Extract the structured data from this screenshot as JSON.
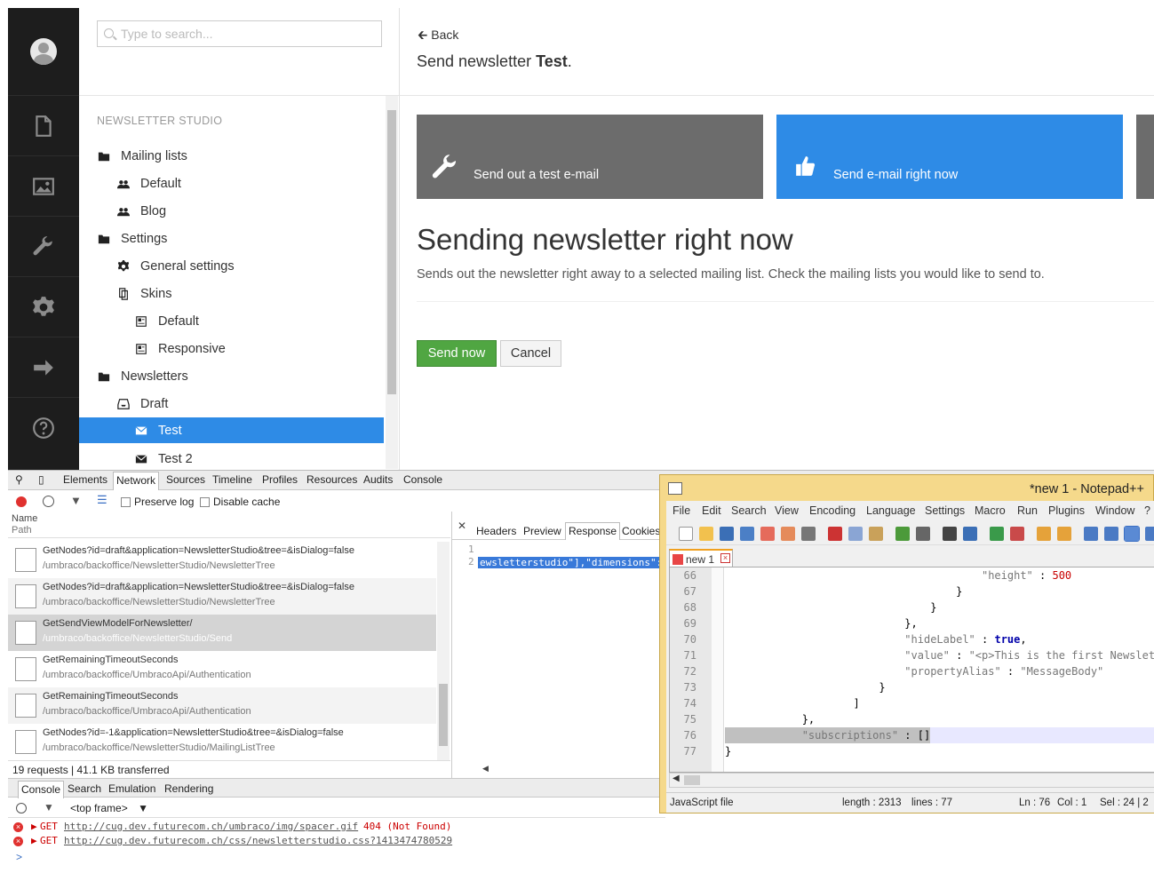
{
  "sidebar": {
    "icons": [
      "avatar",
      "document-icon",
      "image-icon",
      "wrench-icon",
      "gear-icon",
      "arrow-right-icon",
      "help-icon"
    ]
  },
  "tree": {
    "search_placeholder": "Type to search...",
    "section_title": "NEWSLETTER STUDIO",
    "items": [
      {
        "label": "Mailing lists",
        "icon": "folder-icon"
      },
      {
        "label": "Default",
        "icon": "users-icon"
      },
      {
        "label": "Blog",
        "icon": "users-icon"
      },
      {
        "label": "Settings",
        "icon": "folder-icon"
      },
      {
        "label": "General settings",
        "icon": "gear-icon"
      },
      {
        "label": "Skins",
        "icon": "copy-icon"
      },
      {
        "label": "Default",
        "icon": "template-icon"
      },
      {
        "label": "Responsive",
        "icon": "template-icon"
      },
      {
        "label": "Newsletters",
        "icon": "folder-icon"
      },
      {
        "label": "Draft",
        "icon": "inbox-icon"
      },
      {
        "label": "Test",
        "icon": "envelope-icon",
        "selected": true
      },
      {
        "label": "Test 2",
        "icon": "envelope-icon"
      }
    ]
  },
  "main": {
    "back": "Back",
    "header_prefix": "Send newsletter ",
    "header_name": "Test",
    "header_suffix": ".",
    "tiles": [
      {
        "label": "Send out a test e-mail",
        "color": "#6c6c6c",
        "icon": "wrench-icon"
      },
      {
        "label": "Send e-mail right now",
        "color": "#2e8be6",
        "icon": "thumbs-up-icon"
      }
    ],
    "heading": "Sending newsletter right now",
    "description": "Sends out the newsletter right away to a selected mailing list. Check the mailing lists you would like to send to.",
    "send_now": "Send now",
    "cancel": "Cancel",
    "primary_color": "#50a642"
  },
  "devtools": {
    "tabs": [
      "Elements",
      "Network",
      "Sources",
      "Timeline",
      "Profiles",
      "Resources",
      "Audits",
      "Console"
    ],
    "active_tab": "Network",
    "preserve_log": "Preserve log",
    "disable_cache": "Disable cache",
    "col_name": "Name",
    "col_path": "Path",
    "requests": [
      {
        "name": "GetNodes?id=draft&application=NewsletterStudio&tree=&isDialog=false",
        "path": "/umbraco/backoffice/NewsletterStudio/NewsletterTree"
      },
      {
        "name": "GetNodes?id=draft&application=NewsletterStudio&tree=&isDialog=false",
        "path": "/umbraco/backoffice/NewsletterStudio/NewsletterTree"
      },
      {
        "name": "GetSendViewModelForNewsletter/",
        "path": "/umbraco/backoffice/NewsletterStudio/Send"
      },
      {
        "name": "GetRemainingTimeoutSeconds",
        "path": "/umbraco/backoffice/UmbracoApi/Authentication"
      },
      {
        "name": "GetRemainingTimeoutSeconds",
        "path": "/umbraco/backoffice/UmbracoApi/Authentication"
      },
      {
        "name": "GetNodes?id=-1&application=NewsletterStudio&tree=&isDialog=false",
        "path": "/umbraco/backoffice/NewsletterStudio/MailingListTree"
      }
    ],
    "summary": "19 requests | 41.1 KB transferred",
    "response_tabs": [
      "Headers",
      "Preview",
      "Response",
      "Cookies"
    ],
    "response_active": "Response",
    "response_lines": [
      "1",
      "2"
    ],
    "response_text": "ewsletterstudio\"],\"dimensions\":",
    "console_tabs": [
      "Console",
      "Search",
      "Emulation",
      "Rendering"
    ],
    "frame": "<top frame>",
    "console_errors": [
      {
        "method": "GET",
        "url": "http://cug.dev.futurecom.ch/umbraco/img/spacer.gif",
        "status": "404 (Not Found)"
      },
      {
        "method": "GET",
        "url": "http://cug.dev.futurecom.ch/css/newsletterstudio.css?1413474780529",
        "status": ""
      }
    ],
    "prompt": ">"
  },
  "notepad": {
    "title": "*new  1 - Notepad++",
    "menu": [
      "File",
      "Edit",
      "Search",
      "View",
      "Encoding",
      "Language",
      "Settings",
      "Macro",
      "Run",
      "Plugins",
      "Window",
      "?"
    ],
    "tab": "new  1",
    "lines": [
      {
        "n": "66",
        "parts": [
          {
            "t": "                                        ",
            "c": ""
          },
          {
            "t": "\"height\"",
            "c": "str"
          },
          {
            "t": " : ",
            "c": "pun"
          },
          {
            "t": "500",
            "c": "num"
          }
        ]
      },
      {
        "n": "67",
        "parts": [
          {
            "t": "                                    }",
            "c": "pun"
          }
        ]
      },
      {
        "n": "68",
        "parts": [
          {
            "t": "                                }",
            "c": "pun"
          }
        ]
      },
      {
        "n": "69",
        "parts": [
          {
            "t": "                            },",
            "c": "pun"
          }
        ]
      },
      {
        "n": "70",
        "parts": [
          {
            "t": "                            ",
            "c": ""
          },
          {
            "t": "\"hideLabel\"",
            "c": "str"
          },
          {
            "t": " : ",
            "c": "pun"
          },
          {
            "t": "true",
            "c": "kw"
          },
          {
            "t": ",",
            "c": "pun"
          }
        ]
      },
      {
        "n": "71",
        "parts": [
          {
            "t": "                            ",
            "c": ""
          },
          {
            "t": "\"value\"",
            "c": "str"
          },
          {
            "t": " : ",
            "c": "pun"
          },
          {
            "t": "\"<p>This is the first Newsletter fr",
            "c": "str"
          }
        ]
      },
      {
        "n": "72",
        "parts": [
          {
            "t": "                            ",
            "c": ""
          },
          {
            "t": "\"propertyAlias\"",
            "c": "str"
          },
          {
            "t": " : ",
            "c": "pun"
          },
          {
            "t": "\"MessageBody\"",
            "c": "str"
          }
        ]
      },
      {
        "n": "73",
        "parts": [
          {
            "t": "                        }",
            "c": "pun"
          }
        ]
      },
      {
        "n": "74",
        "parts": [
          {
            "t": "                    ]",
            "c": "pun"
          }
        ]
      },
      {
        "n": "75",
        "parts": [
          {
            "t": "            },",
            "c": "pun"
          }
        ]
      },
      {
        "n": "76",
        "parts": [
          {
            "t": "            ",
            "c": ""
          },
          {
            "t": "\"subscriptions\"",
            "c": "str"
          },
          {
            "t": " : ",
            "c": "pun"
          },
          {
            "t": "[]",
            "c": "pun"
          }
        ],
        "highlight": true
      },
      {
        "n": "77",
        "parts": [
          {
            "t": "}",
            "c": "pun"
          }
        ]
      }
    ],
    "status": {
      "type": "JavaScript file",
      "length": "length : 2313",
      "lines": "lines : 77",
      "ln": "Ln : 76",
      "col": "Col : 1",
      "sel": "Sel : 24 | 2"
    }
  }
}
